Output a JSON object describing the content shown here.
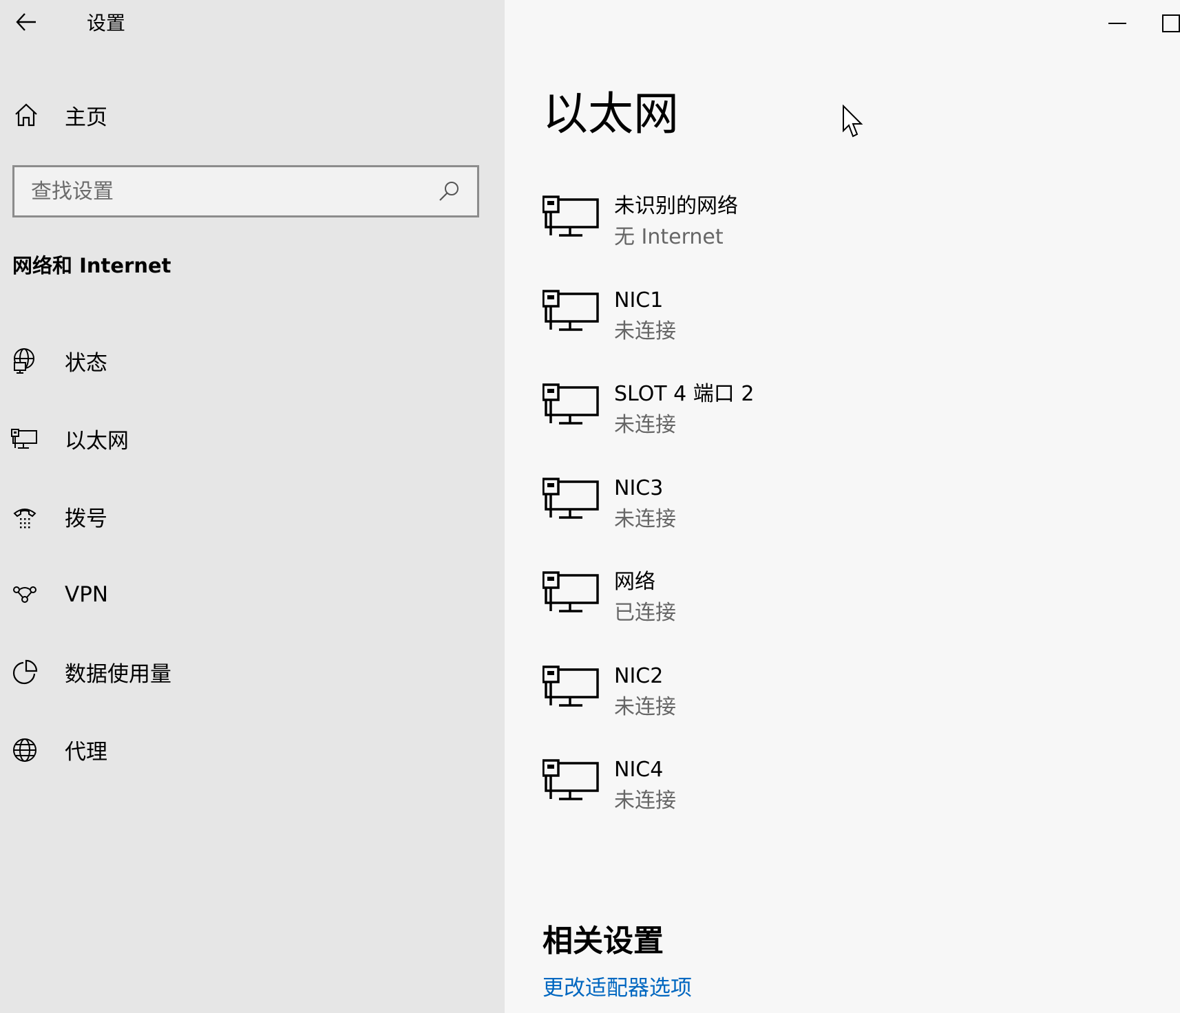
{
  "window": {
    "title": "设置",
    "back_icon": "arrow-left-icon",
    "minimize_icon": "minimize-icon",
    "maximize_icon": "maximize-icon"
  },
  "sidebar": {
    "home": {
      "label": "主页",
      "icon": "home-icon"
    },
    "search": {
      "placeholder": "查找设置",
      "value": "",
      "icon": "search-icon"
    },
    "section_title": "网络和 Internet",
    "items": [
      {
        "label": "状态",
        "icon": "globe-monitor-icon"
      },
      {
        "label": "以太网",
        "icon": "ethernet-icon"
      },
      {
        "label": "拨号",
        "icon": "dialup-icon"
      },
      {
        "label": "VPN",
        "icon": "vpn-icon"
      },
      {
        "label": "数据使用量",
        "icon": "data-usage-icon"
      },
      {
        "label": "代理",
        "icon": "globe-icon"
      }
    ]
  },
  "main": {
    "page_title": "以太网",
    "adapters": [
      {
        "name": "未识别的网络",
        "status": "无 Internet",
        "icon": "ethernet-icon"
      },
      {
        "name": "NIC1",
        "status": "未连接",
        "icon": "ethernet-icon"
      },
      {
        "name": "SLOT 4 端口 2",
        "status": "未连接",
        "icon": "ethernet-icon"
      },
      {
        "name": "NIC3",
        "status": "未连接",
        "icon": "ethernet-icon"
      },
      {
        "name": "网络",
        "status": "已连接",
        "icon": "ethernet-icon"
      },
      {
        "name": "NIC2",
        "status": "未连接",
        "icon": "ethernet-icon"
      },
      {
        "name": "NIC4",
        "status": "未连接",
        "icon": "ethernet-icon"
      }
    ],
    "related_title": "相关设置",
    "related_links": [
      {
        "label": "更改适配器选项"
      }
    ]
  },
  "colors": {
    "sidebar_bg": "#e6e6e6",
    "main_bg": "#f7f7f7",
    "link": "#0067c0",
    "secondary_text": "#666666"
  }
}
